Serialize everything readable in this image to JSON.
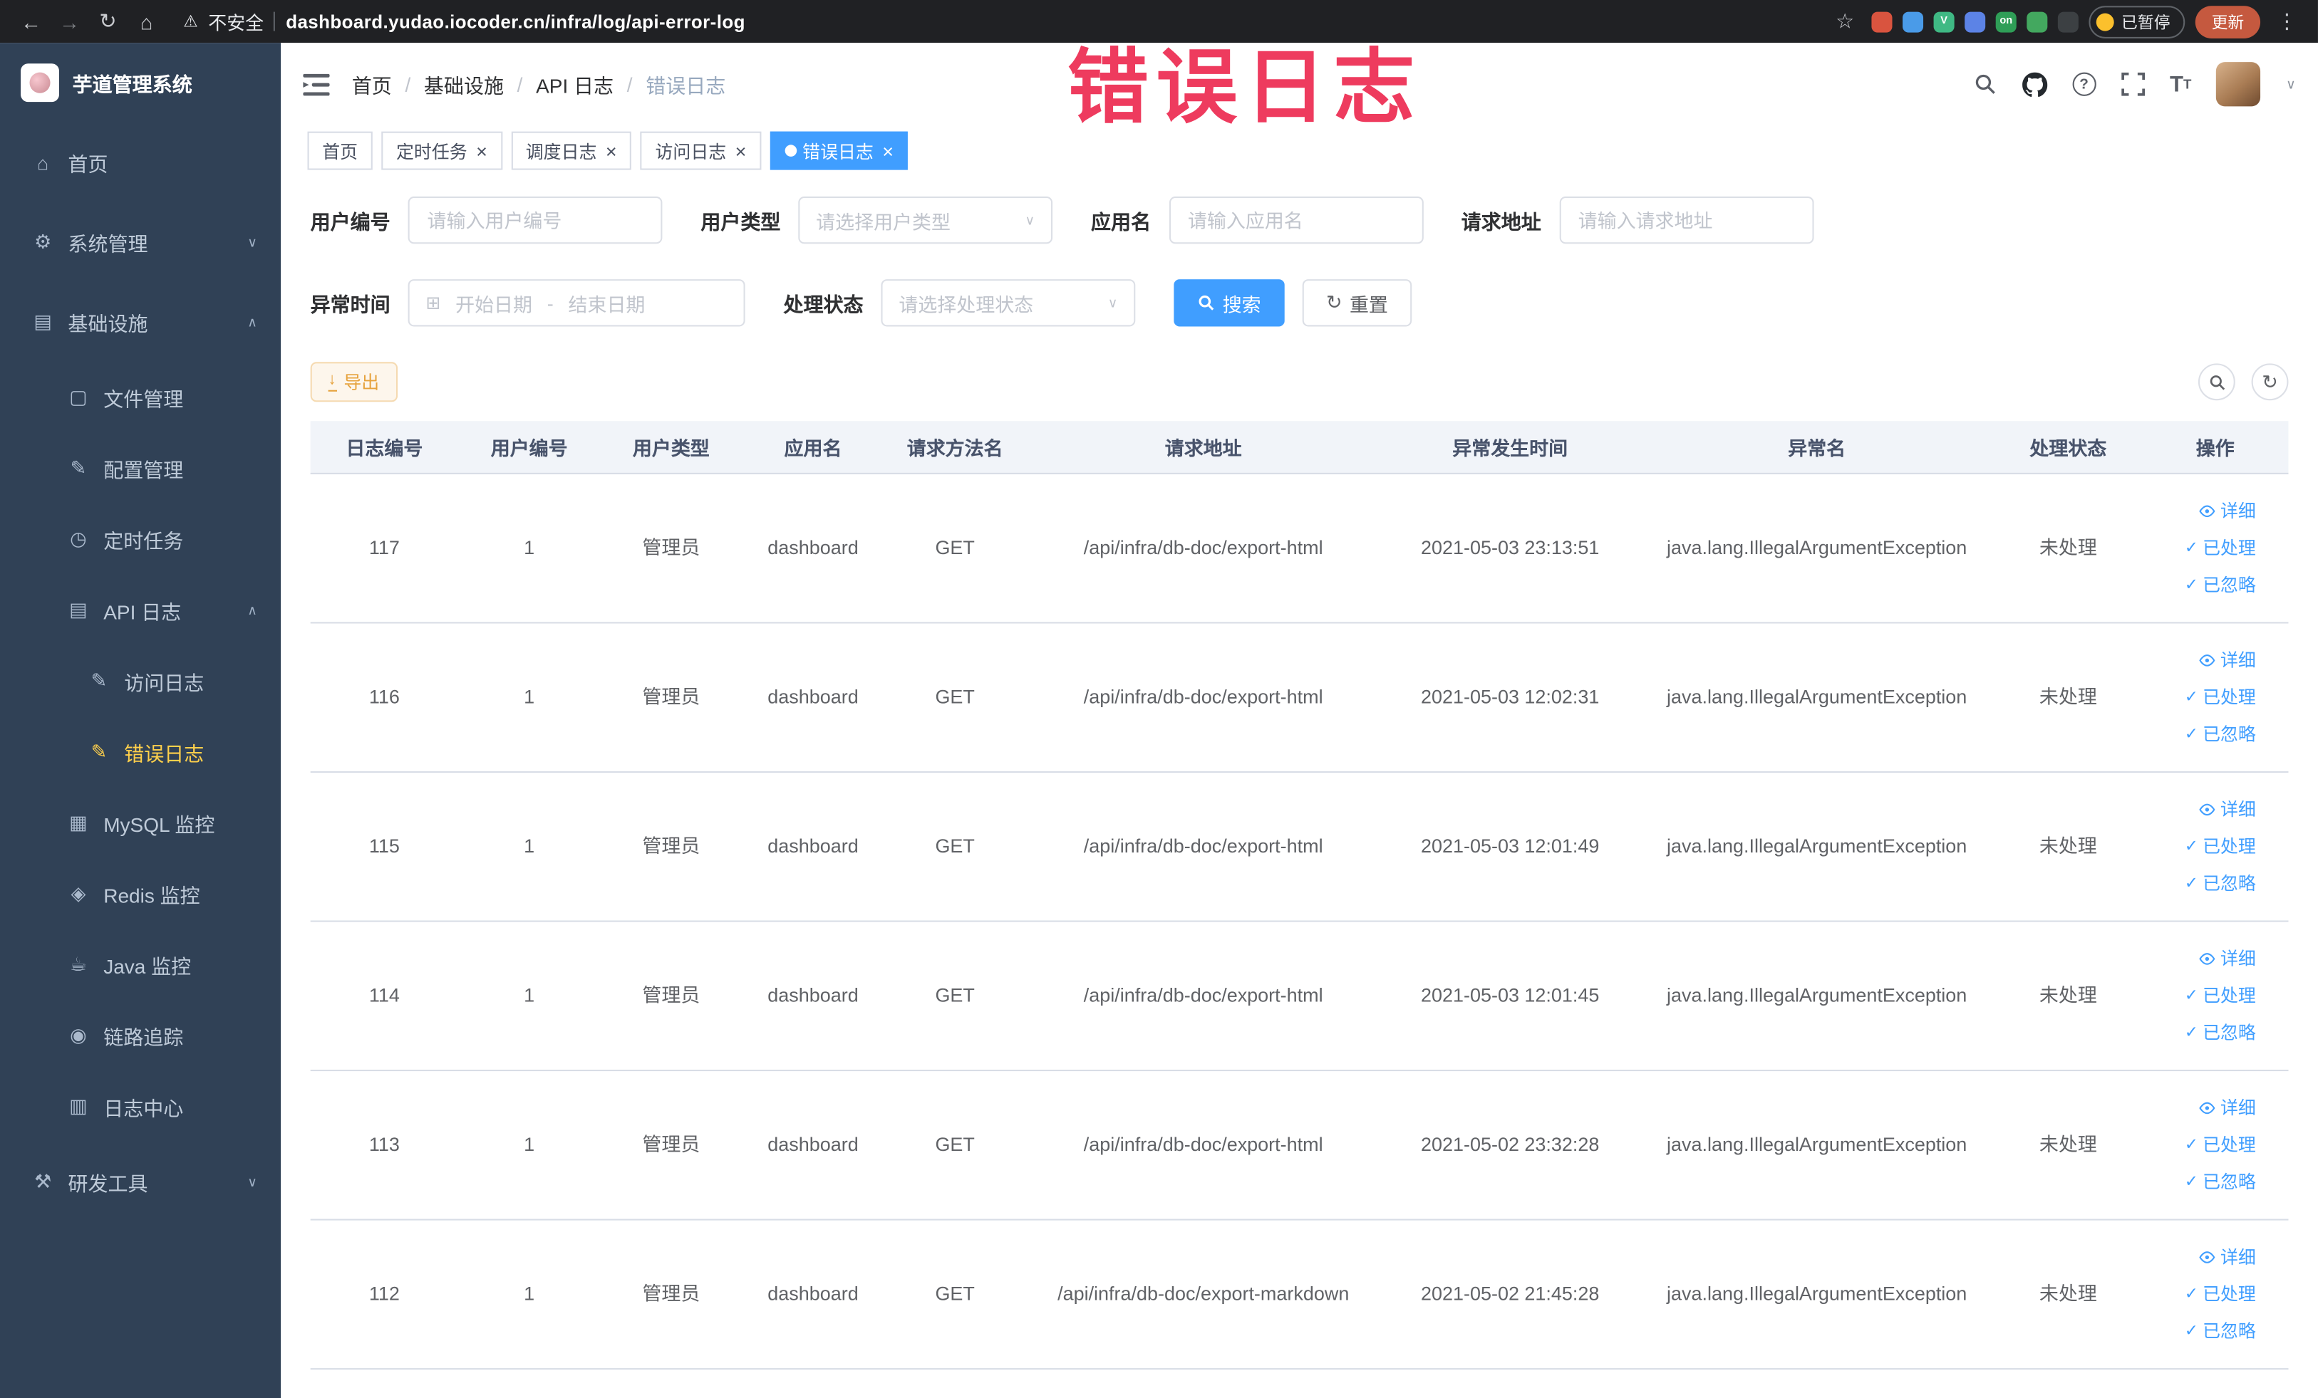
{
  "colors": {
    "accent": "#409eff",
    "sidebar_bg": "#304156",
    "sidebar_active": "#ffd04b",
    "warning": "#e6a23c",
    "annotation_red": "#ee3b5e"
  },
  "annotation": {
    "text": "错误日志"
  },
  "browser": {
    "security_label": "不安全",
    "url": "dashboard.yudao.iocoder.cn/infra/log/api-error-log",
    "paused_label": "已暂停",
    "update_label": "更新",
    "extensions": [
      {
        "name": "red-circle-extension-icon",
        "color": "#d9543f",
        "text": ""
      },
      {
        "name": "blue-drop-extension-icon",
        "color": "#4a9be8",
        "text": ""
      },
      {
        "name": "vue-devtools-extension-icon",
        "color": "#3fb984",
        "text": "V"
      },
      {
        "name": "blue-grid-extension-icon",
        "color": "#5c83e6",
        "text": ""
      },
      {
        "name": "onetab-extension-icon",
        "color": "#2f9e57",
        "text": "on"
      },
      {
        "name": "green-leaf-extension-icon",
        "color": "#43a85f",
        "text": ""
      },
      {
        "name": "dark-pin-extension-icon",
        "color": "#3c4043",
        "text": ""
      }
    ]
  },
  "sidebar": {
    "logo_title": "芋道管理系统",
    "items": [
      {
        "id": "home",
        "label": "首页",
        "icon": "home-icon",
        "glyph": "⌂",
        "level": 1
      },
      {
        "id": "system-management",
        "label": "系统管理",
        "icon": "gear-icon",
        "glyph": "⚙",
        "level": 1,
        "arrow": "down"
      },
      {
        "id": "infrastructure",
        "label": "基础设施",
        "icon": "infrastructure-icon",
        "glyph": "▤",
        "level": 1,
        "arrow": "up"
      },
      {
        "id": "file-management",
        "label": "文件管理",
        "icon": "file-icon",
        "glyph": "▢",
        "level": 2
      },
      {
        "id": "config-management",
        "label": "配置管理",
        "icon": "config-icon",
        "glyph": "✎",
        "level": 2
      },
      {
        "id": "scheduled-jobs",
        "label": "定时任务",
        "icon": "timer-icon",
        "glyph": "◷",
        "level": 2
      },
      {
        "id": "api-logs",
        "label": "API 日志",
        "icon": "api-log-icon",
        "glyph": "▤",
        "level": 2,
        "arrow": "up"
      },
      {
        "id": "access-log",
        "label": "访问日志",
        "icon": "access-log-icon",
        "glyph": "✎",
        "level": 3
      },
      {
        "id": "error-log",
        "label": "错误日志",
        "icon": "error-log-icon",
        "glyph": "✎",
        "level": 3,
        "active": true
      },
      {
        "id": "mysql-monitor",
        "label": "MySQL 监控",
        "icon": "mysql-monitor-icon",
        "glyph": "▦",
        "level": 2
      },
      {
        "id": "redis-monitor",
        "label": "Redis 监控",
        "icon": "redis-monitor-icon",
        "glyph": "◈",
        "level": 2
      },
      {
        "id": "java-monitor",
        "label": "Java 监控",
        "icon": "java-monitor-icon",
        "glyph": "☕",
        "level": 2
      },
      {
        "id": "trace",
        "label": "链路追踪",
        "icon": "trace-icon",
        "glyph": "◉",
        "level": 2
      },
      {
        "id": "log-center",
        "label": "日志中心",
        "icon": "log-center-icon",
        "glyph": "▥",
        "level": 2
      },
      {
        "id": "dev-tools",
        "label": "研发工具",
        "icon": "tools-icon",
        "glyph": "⚒",
        "level": 1,
        "arrow": "down"
      }
    ]
  },
  "header": {
    "breadcrumb": [
      "首页",
      "基础设施",
      "API 日志",
      "错误日志"
    ]
  },
  "tabs": [
    {
      "label": "首页",
      "closable": false,
      "active": false
    },
    {
      "label": "定时任务",
      "closable": true,
      "active": false
    },
    {
      "label": "调度日志",
      "closable": true,
      "active": false
    },
    {
      "label": "访问日志",
      "closable": true,
      "active": false
    },
    {
      "label": "错误日志",
      "closable": true,
      "active": true
    }
  ],
  "filters": {
    "user_id": {
      "label": "用户编号",
      "placeholder": "请输入用户编号"
    },
    "user_type": {
      "label": "用户类型",
      "placeholder": "请选择用户类型"
    },
    "app_name": {
      "label": "应用名",
      "placeholder": "请输入应用名"
    },
    "request_url": {
      "label": "请求地址",
      "placeholder": "请输入请求地址"
    },
    "exception_time": {
      "label": "异常时间",
      "start_placeholder": "开始日期",
      "separator": "-",
      "end_placeholder": "结束日期"
    },
    "process_status": {
      "label": "处理状态",
      "placeholder": "请选择处理状态"
    },
    "search_label": "搜索",
    "reset_label": "重置"
  },
  "toolbar": {
    "export_label": "导出"
  },
  "table": {
    "columns": [
      "日志编号",
      "用户编号",
      "用户类型",
      "应用名",
      "请求方法名",
      "请求地址",
      "异常发生时间",
      "异常名",
      "处理状态",
      "操作"
    ],
    "action_labels": {
      "detail": "详细",
      "processed": "已处理",
      "ignored": "已忽略"
    },
    "rows": [
      {
        "id": "117",
        "user_id": "1",
        "user_type": "管理员",
        "app": "dashboard",
        "method": "GET",
        "url": "/api/infra/db-doc/export-html",
        "time": "2021-05-03 23:13:51",
        "exception": "java.lang.IllegalArgumentException",
        "status": "未处理"
      },
      {
        "id": "116",
        "user_id": "1",
        "user_type": "管理员",
        "app": "dashboard",
        "method": "GET",
        "url": "/api/infra/db-doc/export-html",
        "time": "2021-05-03 12:02:31",
        "exception": "java.lang.IllegalArgumentException",
        "status": "未处理"
      },
      {
        "id": "115",
        "user_id": "1",
        "user_type": "管理员",
        "app": "dashboard",
        "method": "GET",
        "url": "/api/infra/db-doc/export-html",
        "time": "2021-05-03 12:01:49",
        "exception": "java.lang.IllegalArgumentException",
        "status": "未处理"
      },
      {
        "id": "114",
        "user_id": "1",
        "user_type": "管理员",
        "app": "dashboard",
        "method": "GET",
        "url": "/api/infra/db-doc/export-html",
        "time": "2021-05-03 12:01:45",
        "exception": "java.lang.IllegalArgumentException",
        "status": "未处理"
      },
      {
        "id": "113",
        "user_id": "1",
        "user_type": "管理员",
        "app": "dashboard",
        "method": "GET",
        "url": "/api/infra/db-doc/export-html",
        "time": "2021-05-02 23:32:28",
        "exception": "java.lang.IllegalArgumentException",
        "status": "未处理"
      },
      {
        "id": "112",
        "user_id": "1",
        "user_type": "管理员",
        "app": "dashboard",
        "method": "GET",
        "url": "/api/infra/db-doc/export-markdown",
        "time": "2021-05-02 21:45:28",
        "exception": "java.lang.IllegalArgumentException",
        "status": "未处理"
      }
    ]
  }
}
